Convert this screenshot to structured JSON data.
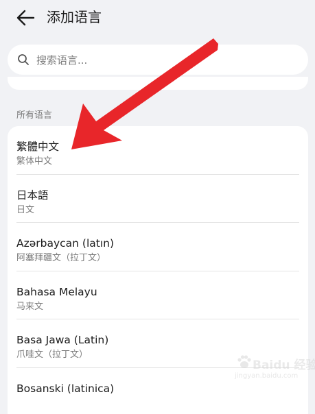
{
  "header": {
    "title": "添加语言"
  },
  "search": {
    "placeholder": "搜索语言..."
  },
  "section": {
    "label": "所有语言"
  },
  "languages": [
    {
      "name": "繁體中文",
      "sub": "繁体中文"
    },
    {
      "name": "日本語",
      "sub": "日文"
    },
    {
      "name": "Azərbaycan (latın)",
      "sub": "阿塞拜疆文（拉丁文）"
    },
    {
      "name": "Bahasa Melayu",
      "sub": "马来文"
    },
    {
      "name": "Basa Jawa (Latin)",
      "sub": "爪哇文（拉丁文）"
    },
    {
      "name": "Bosanski (latinica)",
      "sub": ""
    }
  ],
  "annotation": {
    "arrow_color": "#e8262a"
  },
  "watermark": {
    "brand": "Baidu 经验",
    "url": "jingyan.baidu.com"
  },
  "colors": {
    "background": "#f1f2f5",
    "card": "#ffffff",
    "secondary_text": "#7b7b7b"
  }
}
